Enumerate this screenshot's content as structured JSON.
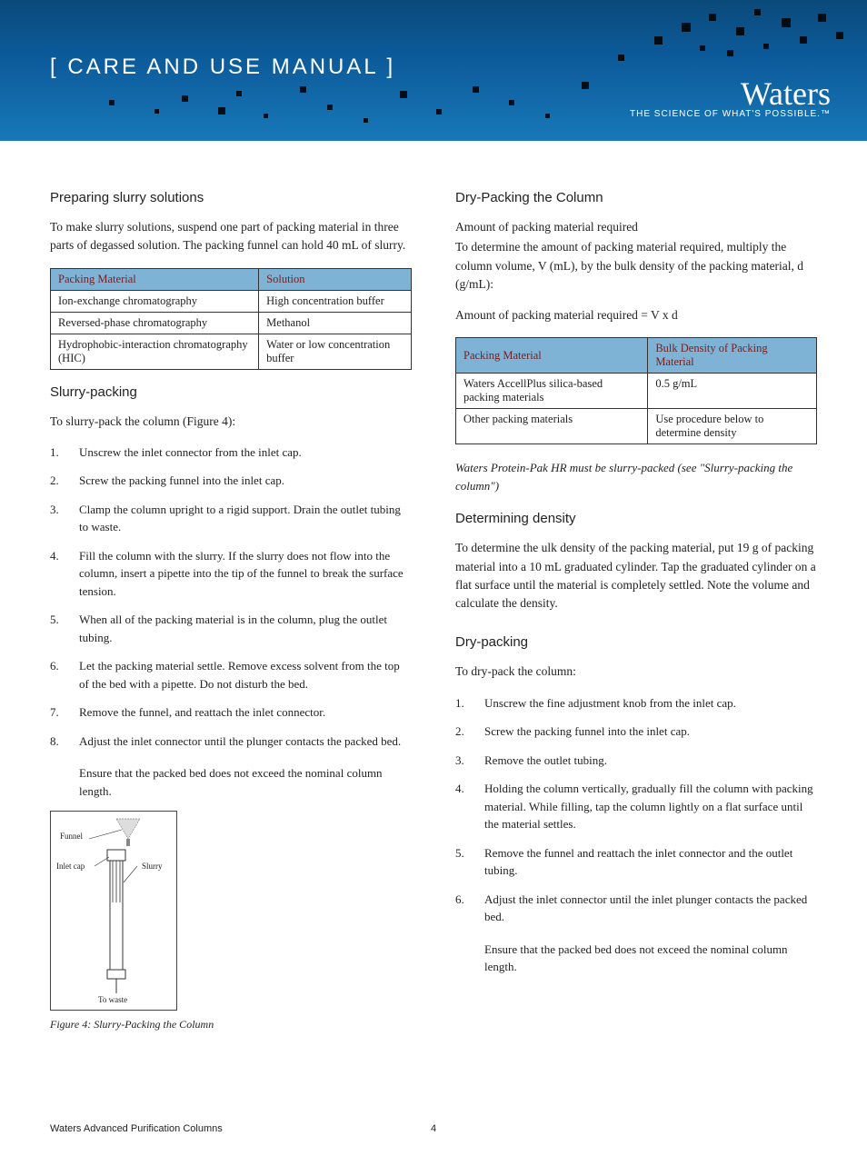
{
  "header": {
    "title": "[ CARE AND USE MANUAL ]",
    "brand": "Waters",
    "tagline": "THE SCIENCE OF WHAT'S POSSIBLE.™"
  },
  "left": {
    "h1": "Preparing slurry solutions",
    "p1": "To make slurry solutions, suspend one part of packing material in three parts of degassed solution. The packing funnel can hold 40 mL of slurry.",
    "table1": {
      "headers": [
        "Packing Material",
        "Solution"
      ],
      "rows": [
        [
          "Ion-exchange chromatography",
          "High concentration buffer"
        ],
        [
          "Reversed-phase chromatography",
          "Methanol"
        ],
        [
          "Hydrophobic-interaction chromatography (HIC)",
          "Water or low concentration buffer"
        ]
      ]
    },
    "h2": "Slurry-packing",
    "p2": "To slurry-pack the column (Figure 4):",
    "steps": [
      "Unscrew the inlet connector from the inlet cap.",
      "Screw the packing funnel into the inlet cap.",
      "Clamp the column upright to a rigid support. Drain the outlet tubing to waste.",
      "Fill the column with the slurry. If the slurry does not flow into the column, insert a pipette into the tip of the funnel to break the surface tension.",
      "When all of the packing material is in the column, plug the outlet tubing.",
      "Let the packing material settle. Remove excess solvent from the top of the bed with a pipette. Do not disturb the bed.",
      "Remove the funnel, and reattach the inlet connector.",
      "Adjust the inlet connector until the plunger contacts the packed bed."
    ],
    "note": "Ensure that the packed bed does not exceed the nominal column length.",
    "fig": {
      "funnel": "Funnel",
      "inletcap": "Inlet cap",
      "slurry": "Slurry",
      "towaste": "To waste",
      "caption": "Figure 4: Slurry-Packing the Column"
    }
  },
  "right": {
    "h1": "Dry-Packing the Column",
    "p1a": "Amount of packing material required",
    "p1b": "To determine the amount of packing material required, multiply the column volume, V (mL), by the bulk density of the packing material, d (g/mL):",
    "p1c": "Amount of packing material required = V x d",
    "table2": {
      "headers": [
        "Packing Material",
        "Bulk Density of Packing Material"
      ],
      "rows": [
        [
          "Waters AccellPlus silica-based packing materials",
          "0.5 g/mL"
        ],
        [
          "Other packing materials",
          "Use procedure below to determine density"
        ]
      ]
    },
    "italic": "Waters Protein-Pak HR must be slurry-packed (see \"Slurry-packing the column\")",
    "h2": "Determining density",
    "p2": "To determine the ulk density of the packing material, put 19 g of packing material into a 10 mL graduated cylinder. Tap the graduated cylinder on a flat surface until the material is completely settled. Note the volume and calculate the density.",
    "h3": "Dry-packing",
    "p3": "To dry-pack the column:",
    "steps": [
      "Unscrew the fine adjustment knob from the inlet cap.",
      "Screw the packing funnel into the inlet cap.",
      "Remove the outlet tubing.",
      "Holding the column vertically, gradually fill the column with packing material. While filling, tap the column lightly on a flat surface until the material settles.",
      "Remove the funnel and reattach the inlet connector and the outlet tubing.",
      "Adjust the inlet connector until the inlet plunger contacts the packed bed."
    ],
    "note": "Ensure that the packed bed does not exceed the nominal column length."
  },
  "footer": {
    "left": "Waters Advanced Purification Columns",
    "page": "4"
  }
}
